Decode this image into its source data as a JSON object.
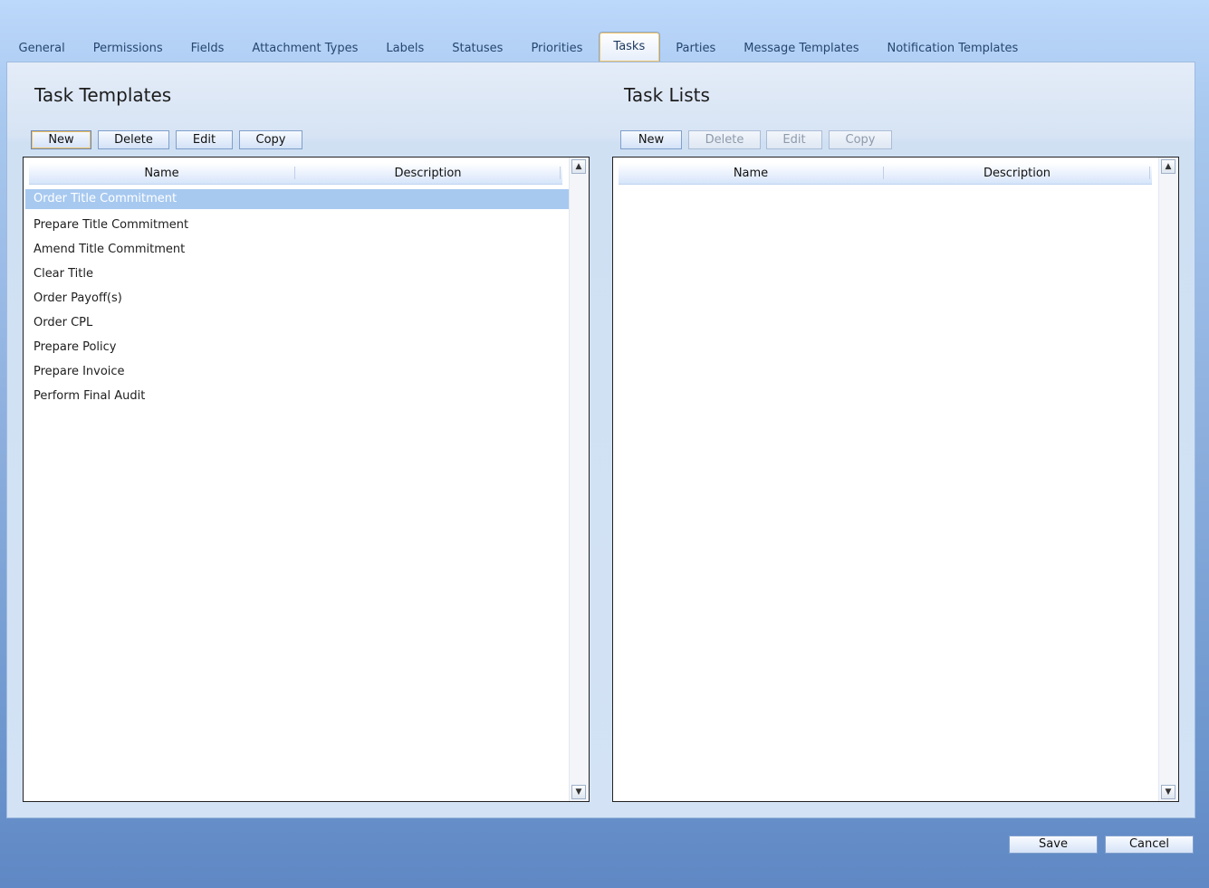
{
  "tabs": [
    "General",
    "Permissions",
    "Fields",
    "Attachment Types",
    "Labels",
    "Statuses",
    "Priorities",
    "Tasks",
    "Parties",
    "Message Templates",
    "Notification Templates"
  ],
  "active_tab": "Tasks",
  "task_templates": {
    "title": "Task Templates",
    "buttons": {
      "new": "New",
      "delete": "Delete",
      "edit": "Edit",
      "copy": "Copy"
    },
    "columns": {
      "name": "Name",
      "description": "Description"
    },
    "rows": [
      "Order Title Commitment",
      "Prepare Title Commitment",
      "Amend Title Commitment",
      "Clear Title",
      "Order Payoff(s)",
      "Order CPL",
      "Prepare Policy",
      "Prepare Invoice",
      "Perform Final Audit"
    ],
    "selected_row": "Order Title Commitment"
  },
  "task_lists": {
    "title": "Task Lists",
    "buttons": {
      "new": "New",
      "delete": "Delete",
      "edit": "Edit",
      "copy": "Copy"
    },
    "disabled_buttons": [
      "Delete",
      "Edit",
      "Copy"
    ],
    "columns": {
      "name": "Name",
      "description": "Description"
    },
    "rows": []
  },
  "footer": {
    "save": "Save",
    "cancel": "Cancel"
  },
  "icons": {
    "scroll_up": "triangle-up-icon",
    "scroll_down": "triangle-down-icon"
  }
}
